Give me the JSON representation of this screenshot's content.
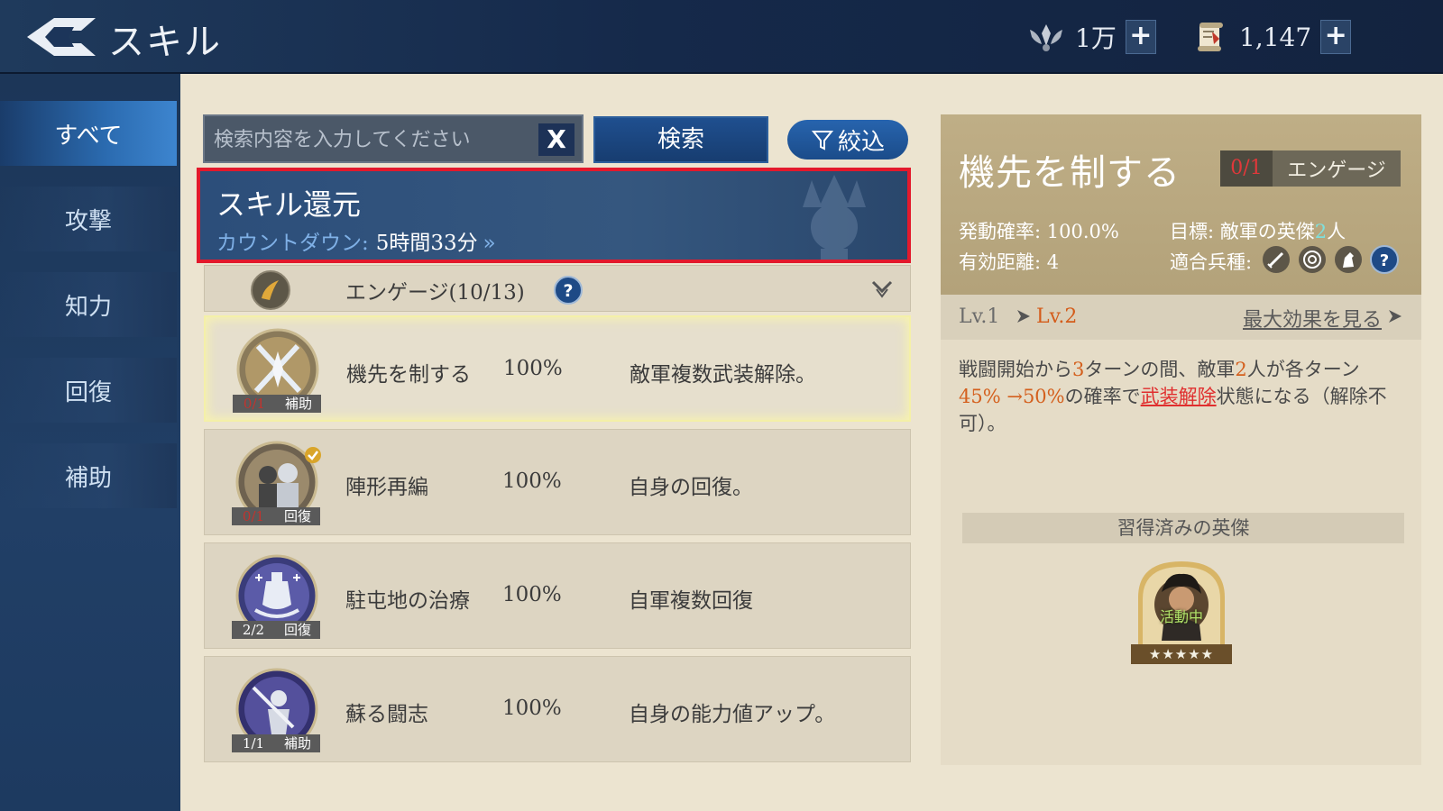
{
  "header": {
    "title": "スキル",
    "resources": [
      {
        "icon": "crown-wings-icon",
        "value": "1万"
      },
      {
        "icon": "scroll-icon",
        "value": "1,147"
      }
    ],
    "plus_label": "+"
  },
  "sidebar": {
    "items": [
      {
        "label": "すべて",
        "active": true
      },
      {
        "label": "攻撃"
      },
      {
        "label": "知力"
      },
      {
        "label": "回復"
      },
      {
        "label": "補助"
      }
    ]
  },
  "search": {
    "placeholder": "検索内容を入力してください",
    "value": "",
    "clear_label": "X",
    "button_label": "検索",
    "filter_label": "絞込"
  },
  "banner": {
    "title": "スキル還元",
    "countdown_label": "カウントダウン:",
    "countdown_value": "5時間33分",
    "chevron": "»"
  },
  "category": {
    "label": "エンゲージ(10/13)"
  },
  "skills": [
    {
      "name": "機先を制する",
      "rate": "100%",
      "desc": "敵軍複数武装解除。",
      "count": "0/1",
      "type": "補助"
    },
    {
      "name": "陣形再編",
      "rate": "100%",
      "desc": "自身の回復。",
      "count": "0/1",
      "type": "回復"
    },
    {
      "name": "駐屯地の治療",
      "rate": "100%",
      "desc": "自軍複数回復",
      "count": "2/2",
      "type": "回復"
    },
    {
      "name": "蘇る闘志",
      "rate": "100%",
      "desc": "自身の能力値アップ。",
      "count": "1/1",
      "type": "補助"
    }
  ],
  "detail": {
    "title": "機先を制する",
    "engage_count": "0/1",
    "engage_label": "エンゲージ",
    "activation_label": "発動確率:",
    "activation_value": "100.0%",
    "target_label": "目標:",
    "target_prefix": "敵軍の英傑",
    "target_count": "2",
    "target_suffix": "人",
    "range_label": "有効距離:",
    "range_value": "4",
    "troops_label": "適合兵種:",
    "lv_from": "Lv.1",
    "lv_to": "Lv.2",
    "max_effect_label": "最大効果を見る",
    "desc_parts": [
      {
        "text": "戦闘開始から",
        "style": "n"
      },
      {
        "text": "3",
        "style": "o"
      },
      {
        "text": "ターンの間、敵軍",
        "style": "n"
      },
      {
        "text": "2",
        "style": "o"
      },
      {
        "text": "人が各ターン",
        "style": "n"
      },
      {
        "text": "45% →50%",
        "style": "o"
      },
      {
        "text": "の確率で",
        "style": "n"
      },
      {
        "text": "武装解除",
        "style": "r"
      },
      {
        "text": "状態になる（解除不可）。",
        "style": "n"
      }
    ],
    "learned_title": "習得済みの英傑",
    "hero_status": "活動中",
    "hero_stars": "★★★★★"
  },
  "colors": {
    "header_bg": "#15294a",
    "sidebar_active": "#2b6bb0",
    "panel_bg": "#e5dcc7",
    "detail_head": "#b3a27a",
    "highlight_red": "#e3192c",
    "orange_text": "#d4601e"
  }
}
